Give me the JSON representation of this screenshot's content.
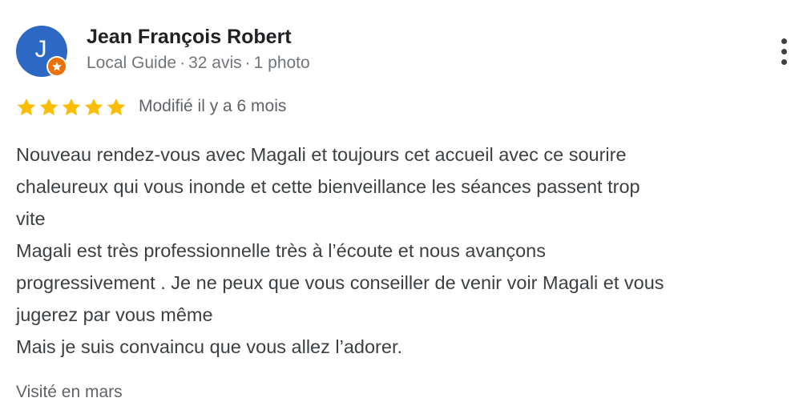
{
  "reviewer": {
    "initial": "J",
    "name": "Jean François Robert",
    "role": "Local Guide",
    "reviews_count": "32 avis",
    "photos_count": "1 photo",
    "separator": "·",
    "avatar_color": "#2d68c4",
    "badge_color": "#e8710a"
  },
  "rating": {
    "stars": 5,
    "max": 5,
    "star_color": "#fbbc04",
    "modified": "Modifié il y a 6 mois"
  },
  "review_lines": [
    "Nouveau rendez-vous avec Magali et toujours cet accueil avec ce sourire",
    "chaleureux qui vous inonde et cette bienveillance les séances passent trop",
    "vite",
    "Magali est très professionnelle très à l’écoute et nous avançons",
    "progressivement . Je ne peux que vous conseiller de venir voir Magali et vous",
    "jugerez par vous même",
    "Mais je suis convaincu que vous allez l’adorer."
  ],
  "visited": "Visité en mars",
  "icons": {
    "more": "more-vert-icon",
    "star": "star-icon",
    "local_guide": "local-guide-star-icon"
  }
}
